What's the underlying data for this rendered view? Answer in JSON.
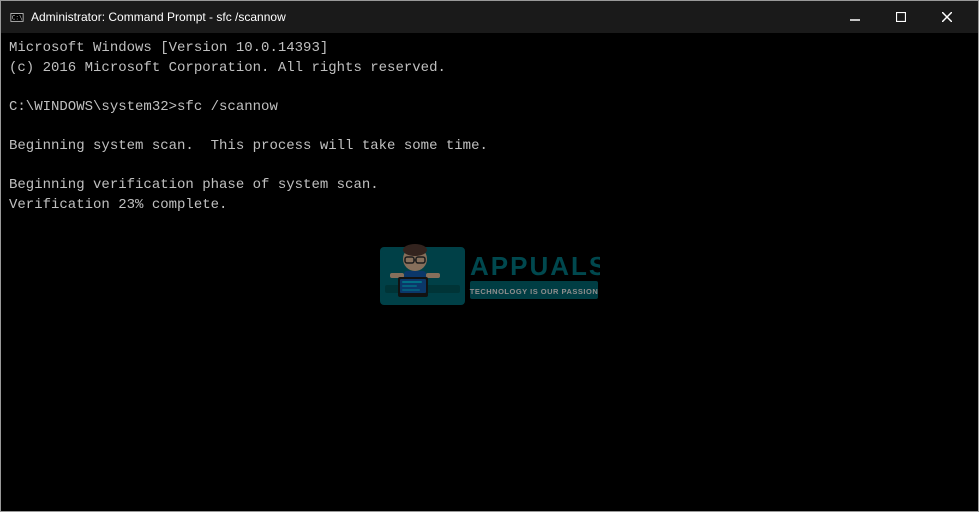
{
  "window": {
    "title": "Administrator: Command Prompt - sfc  /scannow",
    "icon": "cmd-icon"
  },
  "titlebar": {
    "minimize_label": "minimize",
    "maximize_label": "maximize",
    "close_label": "close"
  },
  "console": {
    "lines": [
      "Microsoft Windows [Version 10.0.14393]",
      "(c) 2016 Microsoft Corporation. All rights reserved.",
      "",
      "C:\\WINDOWS\\system32>sfc /scannow",
      "",
      "Beginning system scan.  This process will take some time.",
      "",
      "Beginning verification phase of system scan.",
      "Verification 23% complete."
    ]
  }
}
